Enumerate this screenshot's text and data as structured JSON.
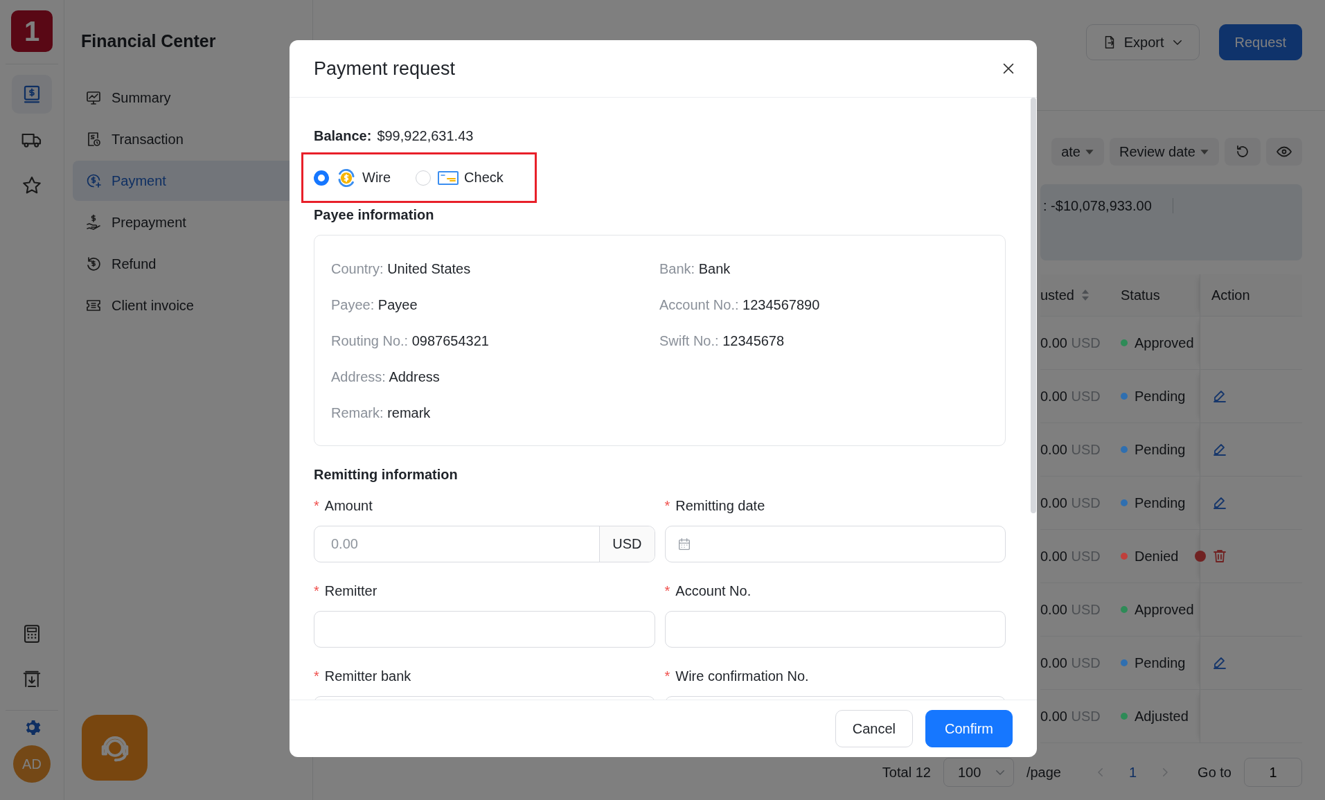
{
  "rail": {
    "logo": "1",
    "items": [
      {
        "kind": "ledger",
        "selected": true
      },
      {
        "kind": "truck",
        "selected": false
      },
      {
        "kind": "star",
        "selected": false
      }
    ],
    "bottom_items": [
      {
        "kind": "calculator"
      },
      {
        "kind": "download"
      }
    ],
    "avatar": "AD"
  },
  "sidebar": {
    "title": "Financial Center",
    "items": [
      {
        "label": "Summary",
        "kind": "chart",
        "selected": false
      },
      {
        "label": "Transaction",
        "kind": "receipt",
        "selected": false
      },
      {
        "label": "Payment",
        "kind": "dollar-plus",
        "selected": true
      },
      {
        "label": "Prepayment",
        "kind": "hand-dollar",
        "selected": false
      },
      {
        "label": "Refund",
        "kind": "refund",
        "selected": false
      },
      {
        "label": "Client invoice",
        "kind": "ticket",
        "selected": false
      }
    ]
  },
  "page": {
    "buttons": [
      {
        "label": "Export",
        "kind": "export"
      },
      {
        "label": "Request",
        "kind": "primary"
      }
    ]
  },
  "filters": [
    {
      "label": "ate"
    },
    {
      "label": "Review date"
    }
  ],
  "summary": ": -$10,078,933.00",
  "table": {
    "columns": [
      {
        "label": "usted",
        "sortable": true
      },
      {
        "label": "Status",
        "sortable": false
      },
      {
        "label": "Action",
        "sortable": false
      }
    ],
    "rows": [
      {
        "amount": "0.00",
        "currency": "USD",
        "status": "Approved",
        "color": "#2e8b57",
        "kind": "none",
        "alert": false
      },
      {
        "amount": "0.00",
        "currency": "USD",
        "status": "Pending",
        "color": "#2f6fb0",
        "kind": "edit",
        "alert": false
      },
      {
        "amount": "0.00",
        "currency": "USD",
        "status": "Pending",
        "color": "#2f6fb0",
        "kind": "edit",
        "alert": false
      },
      {
        "amount": "0.00",
        "currency": "USD",
        "status": "Pending",
        "color": "#2f6fb0",
        "kind": "edit",
        "alert": false
      },
      {
        "amount": "0.00",
        "currency": "USD",
        "status": "Denied",
        "color": "#c0403c",
        "kind": "delete",
        "alert": true
      },
      {
        "amount": "0.00",
        "currency": "USD",
        "status": "Approved",
        "color": "#2e8b57",
        "kind": "none",
        "alert": false
      },
      {
        "amount": "0.00",
        "currency": "USD",
        "status": "Pending",
        "color": "#2f6fb0",
        "kind": "edit",
        "alert": false
      },
      {
        "amount": "0.00",
        "currency": "USD",
        "status": "Adjusted",
        "color": "#2e8b57",
        "kind": "none",
        "alert": false
      }
    ]
  },
  "pagination": {
    "total": "Total 12",
    "page_size": "100",
    "per_page": "/page",
    "pages": [
      {
        "label": "1",
        "selected": true
      }
    ],
    "goto_label": "Go to",
    "goto_value": "1"
  },
  "modal": {
    "title": "Payment request",
    "balance_label": "Balance:",
    "balance": "$99,922,631.43",
    "methods_highlighted": true,
    "methods": [
      {
        "label": "Wire",
        "kind": "wire",
        "selected": true
      },
      {
        "label": "Check",
        "kind": "check",
        "selected": false
      }
    ],
    "payee_heading": "Payee information",
    "payee": [
      [
        {
          "label": "Country:",
          "value": "United States"
        },
        {
          "label": "Bank:",
          "value": "Bank"
        }
      ],
      [
        {
          "label": "Payee:",
          "value": "Payee"
        },
        {
          "label": "Account No.:",
          "value": "1234567890"
        }
      ],
      [
        {
          "label": "Routing No.:",
          "value": "0987654321"
        },
        {
          "label": "Swift No.:",
          "value": "12345678"
        }
      ],
      [
        {
          "label": "Address:",
          "value": "Address"
        }
      ],
      [
        {
          "label": "Remark:",
          "value": "remark"
        }
      ]
    ],
    "remit_heading": "Remitting information",
    "fields": [
      {
        "label": "Amount",
        "mark": "*",
        "kind": "amount",
        "placeholder": "0.00",
        "suffix": "USD"
      },
      {
        "label": "Remitting date",
        "mark": "*",
        "kind": "date"
      },
      {
        "label": "Remitter",
        "mark": "*",
        "kind": "text"
      },
      {
        "label": "Account No.",
        "mark": "*",
        "kind": "text"
      },
      {
        "label": "Remitter bank",
        "mark": "*",
        "kind": "text"
      },
      {
        "label": "Wire confirmation No.",
        "mark": "*",
        "kind": "text"
      }
    ],
    "buttons": [
      {
        "label": "Cancel",
        "kind": "default"
      },
      {
        "label": "Confirm",
        "kind": "primary"
      }
    ]
  }
}
